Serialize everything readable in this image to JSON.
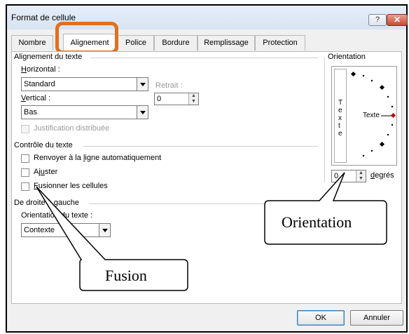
{
  "window": {
    "title": "Format de cellule",
    "help_label": "?",
    "close_label": "✕"
  },
  "tabs": [
    {
      "label": "Nombre"
    },
    {
      "label": "Alignement"
    },
    {
      "label": "Police"
    },
    {
      "label": "Bordure"
    },
    {
      "label": "Remplissage"
    },
    {
      "label": "Protection"
    }
  ],
  "alignment": {
    "section_title": "Alignement du texte",
    "horizontal_label": "Horizontal :",
    "horizontal_value": "Standard",
    "retrait_label": "Retrait :",
    "retrait_value": "0",
    "vertical_label": "Vertical :",
    "vertical_value": "Bas",
    "justification_label": "Justification distribuée"
  },
  "text_control": {
    "section_title": "Contrôle du texte",
    "wrap_label": "Renvoyer à la ligne automatiquement",
    "shrink_label": "Ajuster",
    "merge_label": "Fusionner les cellules"
  },
  "rtl": {
    "section_title": "De droite à gauche",
    "direction_label": "Orientation du texte :",
    "direction_value": "Contexte"
  },
  "orientation": {
    "section_title": "Orientation",
    "vertical_text": [
      "T",
      "e",
      "x",
      "t",
      "e"
    ],
    "dial_text": "Texte",
    "degrees_value": "0",
    "degrees_label": "degrés"
  },
  "footer": {
    "ok_label": "OK",
    "cancel_label": "Annuler"
  },
  "callouts": {
    "orientation": "Orientation",
    "fusion": "Fusion"
  },
  "colors": {
    "highlight": "#e07020",
    "diamond_active": "#c00000"
  }
}
